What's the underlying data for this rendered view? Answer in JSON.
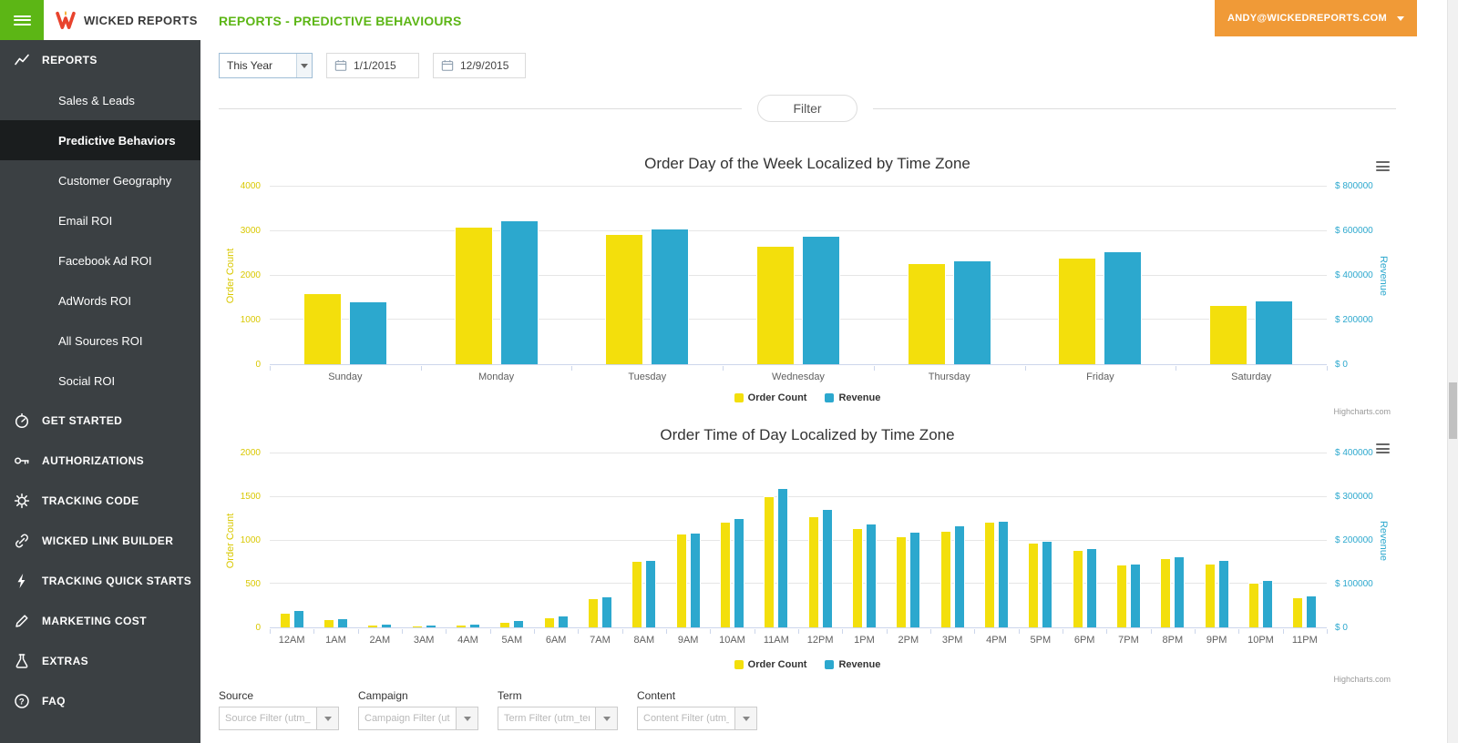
{
  "brand": {
    "name": "WICKED REPORTS"
  },
  "header": {
    "title": "REPORTS - PREDICTIVE BEHAVIOURS",
    "account_label": "ANDY@WICKEDREPORTS.COM"
  },
  "toolbar": {
    "period_value": "This Year",
    "date_from": "1/1/2015",
    "date_to": "12/9/2015",
    "filter_label": "Filter"
  },
  "sidebar": {
    "reports_label": "REPORTS",
    "report_items": [
      {
        "label": "Sales & Leads",
        "active": false
      },
      {
        "label": "Predictive Behaviors",
        "active": true
      },
      {
        "label": "Customer Geography",
        "active": false
      },
      {
        "label": "Email ROI",
        "active": false
      },
      {
        "label": "Facebook Ad ROI",
        "active": false
      },
      {
        "label": "AdWords ROI",
        "active": false
      },
      {
        "label": "All Sources ROI",
        "active": false
      },
      {
        "label": "Social ROI",
        "active": false
      }
    ],
    "sections": [
      {
        "label": "GET STARTED",
        "icon": "speedometer-icon"
      },
      {
        "label": "AUTHORIZATIONS",
        "icon": "key-icon"
      },
      {
        "label": "TRACKING CODE",
        "icon": "gear-icon"
      },
      {
        "label": "WICKED LINK BUILDER",
        "icon": "link-icon"
      },
      {
        "label": "TRACKING QUICK STARTS",
        "icon": "lightning-icon"
      },
      {
        "label": "MARKETING COST",
        "icon": "pencil-icon"
      },
      {
        "label": "EXTRAS",
        "icon": "flask-icon"
      },
      {
        "label": "FAQ",
        "icon": "question-icon"
      }
    ]
  },
  "filters": {
    "groups": [
      {
        "label": "Source",
        "placeholder": "Source Filter (utm_sou"
      },
      {
        "label": "Campaign",
        "placeholder": "Campaign Filter (utm_"
      },
      {
        "label": "Term",
        "placeholder": "Term Filter (utm_term)"
      },
      {
        "label": "Content",
        "placeholder": "Content Filter (utm_co"
      }
    ]
  },
  "theme": {
    "accent_green": "#5CB615",
    "brand_orange": "#F09A37",
    "sidebar_bg": "#3B4043",
    "sidebar_active_bg": "#1A1D1E"
  },
  "chart_data": [
    {
      "type": "bar",
      "title": "Order Day of the Week Localized by Time Zone",
      "categories": [
        "Sunday",
        "Monday",
        "Tuesday",
        "Wednesday",
        "Thursday",
        "Friday",
        "Saturday"
      ],
      "series": [
        {
          "name": "Order Count",
          "axis": "left",
          "color": "#F3DF0C",
          "values": [
            1600,
            3100,
            2930,
            2670,
            2280,
            2400,
            1330
          ]
        },
        {
          "name": "Revenue",
          "axis": "right",
          "color": "#2CA8CE",
          "values": [
            283000,
            648000,
            613000,
            577000,
            467000,
            508000,
            287000
          ]
        }
      ],
      "left_axis": {
        "title": "Order Count",
        "min": 0,
        "max": 4000,
        "tick_labels": [
          "0",
          "1000",
          "2000",
          "3000",
          "4000"
        ],
        "color": "#D9C800"
      },
      "right_axis": {
        "title": "Revenue",
        "min": 0,
        "max": 800000,
        "tick_labels": [
          "$ 0",
          "$ 200000",
          "$ 400000",
          "$ 600000",
          "$ 800000"
        ],
        "color": "#2CA8CE"
      },
      "grid": true,
      "legend_position": "bottom",
      "credits": "Highcharts.com"
    },
    {
      "type": "bar",
      "title": "Order Time of Day Localized by Time Zone",
      "categories": [
        "12AM",
        "1AM",
        "2AM",
        "3AM",
        "4AM",
        "5AM",
        "6AM",
        "7AM",
        "8AM",
        "9AM",
        "10AM",
        "11AM",
        "12PM",
        "1PM",
        "2PM",
        "3PM",
        "4PM",
        "5PM",
        "6PM",
        "7PM",
        "8PM",
        "9PM",
        "10PM",
        "11PM"
      ],
      "series": [
        {
          "name": "Order Count",
          "axis": "left",
          "color": "#F3DF0C",
          "values": [
            170,
            95,
            35,
            25,
            35,
            65,
            120,
            340,
            760,
            1080,
            1220,
            1510,
            1280,
            1140,
            1050,
            1110,
            1220,
            970,
            890,
            720,
            800,
            730,
            515,
            350
          ]
        },
        {
          "name": "Revenue",
          "axis": "right",
          "color": "#2CA8CE",
          "values": [
            40000,
            22000,
            9000,
            7000,
            9000,
            16000,
            27000,
            72000,
            155000,
            218000,
            252000,
            320000,
            272000,
            238000,
            220000,
            234000,
            246000,
            198000,
            182000,
            146000,
            164000,
            154000,
            108000,
            74000
          ]
        }
      ],
      "left_axis": {
        "title": "Order Count",
        "min": 0,
        "max": 2000,
        "tick_labels": [
          "0",
          "500",
          "1000",
          "1500",
          "2000"
        ],
        "color": "#D9C800"
      },
      "right_axis": {
        "title": "Revenue",
        "min": 0,
        "max": 400000,
        "tick_labels": [
          "$ 0",
          "$ 100000",
          "$ 200000",
          "$ 300000",
          "$ 400000"
        ],
        "color": "#2CA8CE"
      },
      "grid": true,
      "legend_position": "bottom",
      "credits": "Highcharts.com"
    }
  ]
}
